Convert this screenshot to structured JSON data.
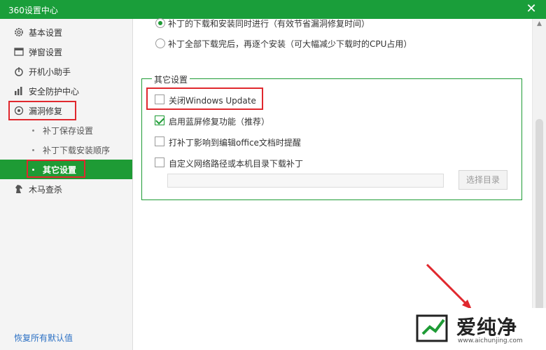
{
  "window": {
    "title": "360设置中心"
  },
  "sidebar": {
    "items": [
      {
        "label": "基本设置",
        "icon": "gear-icon"
      },
      {
        "label": "弹窗设置",
        "icon": "window-icon"
      },
      {
        "label": "开机小助手",
        "icon": "power-icon"
      },
      {
        "label": "安全防护中心",
        "icon": "bars-icon"
      },
      {
        "label": "漏洞修复",
        "icon": "patch-icon"
      },
      {
        "label": "木马查杀",
        "icon": "horse-icon"
      }
    ],
    "sub_items": [
      {
        "label": "补丁保存设置"
      },
      {
        "label": "补丁下载安装顺序"
      },
      {
        "label": "其它设置"
      }
    ],
    "restore_label": "恢复所有默认值"
  },
  "main": {
    "radio1_label": "补丁的下载和安装同时进行（有效节省漏洞修复时间）",
    "radio2_label": "补丁全部下载完后，再逐个安装（可大幅减少下载时的CPU占用）",
    "group_title": "其它设置",
    "options": [
      {
        "label": "关闭Windows Update",
        "checked": false
      },
      {
        "label": "启用蓝屏修复功能（推荐）",
        "checked": true
      },
      {
        "label": "打补丁影响到编辑office文档时提醒",
        "checked": false
      },
      {
        "label": "自定义网络路径或本机目录下载补丁",
        "checked": false
      }
    ],
    "path_value": "",
    "select_dir_label": "选择目录"
  },
  "watermark": {
    "brand": "爱纯净",
    "url": "www.aichunjing.com"
  },
  "colors": {
    "accent": "#1e9b35",
    "highlight": "#e0282e",
    "link": "#2b70c4"
  }
}
